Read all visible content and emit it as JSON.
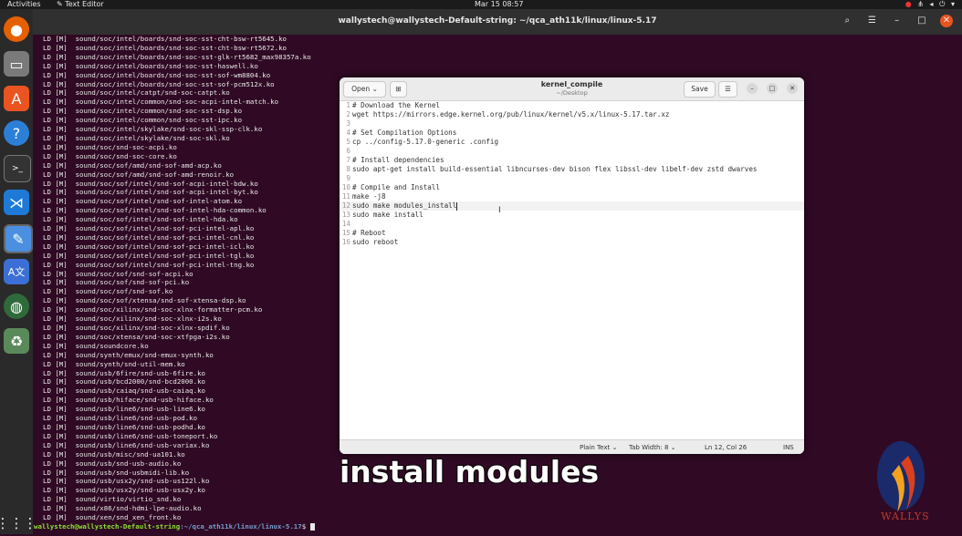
{
  "topbar": {
    "activities": "Activities",
    "app_name": "Text Editor",
    "clock": "Mar 15  08:57"
  },
  "terminal": {
    "title": "wallystech@wallystech-Default-string: ~/qca_ath11k/linux/linux-5.17",
    "lines": [
      "LD [M]  sound/soc/intel/boards/snd-soc-sst-cht-bsw-rt5645.ko",
      "LD [M]  sound/soc/intel/boards/snd-soc-sst-cht-bsw-rt5672.ko",
      "LD [M]  sound/soc/intel/boards/snd-soc-sst-glk-rt5682_max98357a.ko",
      "LD [M]  sound/soc/intel/boards/snd-soc-sst-haswell.ko",
      "LD [M]  sound/soc/intel/boards/snd-soc-sst-sof-wm8804.ko",
      "LD [M]  sound/soc/intel/boards/snd-soc-sst-sof-pcm512x.ko",
      "LD [M]  sound/soc/intel/catpt/snd-soc-catpt.ko",
      "LD [M]  sound/soc/intel/common/snd-soc-acpi-intel-match.ko",
      "LD [M]  sound/soc/intel/common/snd-soc-sst-dsp.ko",
      "LD [M]  sound/soc/intel/common/snd-soc-sst-ipc.ko",
      "LD [M]  sound/soc/intel/skylake/snd-soc-skl-ssp-clk.ko",
      "LD [M]  sound/soc/intel/skylake/snd-soc-skl.ko",
      "LD [M]  sound/soc/snd-soc-acpi.ko",
      "LD [M]  sound/soc/snd-soc-core.ko",
      "LD [M]  sound/soc/sof/amd/snd-sof-amd-acp.ko",
      "LD [M]  sound/soc/sof/amd/snd-sof-amd-renoir.ko",
      "LD [M]  sound/soc/sof/intel/snd-sof-acpi-intel-bdw.ko",
      "LD [M]  sound/soc/sof/intel/snd-sof-acpi-intel-byt.ko",
      "LD [M]  sound/soc/sof/intel/snd-sof-intel-atom.ko",
      "LD [M]  sound/soc/sof/intel/snd-sof-intel-hda-common.ko",
      "LD [M]  sound/soc/sof/intel/snd-sof-intel-hda.ko",
      "LD [M]  sound/soc/sof/intel/snd-sof-pci-intel-apl.ko",
      "LD [M]  sound/soc/sof/intel/snd-sof-pci-intel-cnl.ko",
      "LD [M]  sound/soc/sof/intel/snd-sof-pci-intel-icl.ko",
      "LD [M]  sound/soc/sof/intel/snd-sof-pci-intel-tgl.ko",
      "LD [M]  sound/soc/sof/intel/snd-sof-pci-intel-tng.ko",
      "LD [M]  sound/soc/sof/snd-sof-acpi.ko",
      "LD [M]  sound/soc/sof/snd-sof-pci.ko",
      "LD [M]  sound/soc/sof/snd-sof.ko",
      "LD [M]  sound/soc/sof/xtensa/snd-sof-xtensa-dsp.ko",
      "LD [M]  sound/soc/xilinx/snd-soc-xlnx-formatter-pcm.ko",
      "LD [M]  sound/soc/xilinx/snd-soc-xlnx-i2s.ko",
      "LD [M]  sound/soc/xilinx/snd-soc-xlnx-spdif.ko",
      "LD [M]  sound/soc/xtensa/snd-soc-xtfpga-i2s.ko",
      "LD [M]  sound/soundcore.ko",
      "LD [M]  sound/synth/emux/snd-emux-synth.ko",
      "LD [M]  sound/synth/snd-util-mem.ko",
      "LD [M]  sound/usb/6fire/snd-usb-6fire.ko",
      "LD [M]  sound/usb/bcd2000/snd-bcd2000.ko",
      "LD [M]  sound/usb/caiaq/snd-usb-caiaq.ko",
      "LD [M]  sound/usb/hiface/snd-usb-hiface.ko",
      "LD [M]  sound/usb/line6/snd-usb-line6.ko",
      "LD [M]  sound/usb/line6/snd-usb-pod.ko",
      "LD [M]  sound/usb/line6/snd-usb-podhd.ko",
      "LD [M]  sound/usb/line6/snd-usb-toneport.ko",
      "LD [M]  sound/usb/line6/snd-usb-variax.ko",
      "LD [M]  sound/usb/misc/snd-ua101.ko",
      "LD [M]  sound/usb/snd-usb-audio.ko",
      "LD [M]  sound/usb/snd-usbmidi-lib.ko",
      "LD [M]  sound/usb/usx2y/snd-usb-us122l.ko",
      "LD [M]  sound/usb/usx2y/snd-usb-usx2y.ko",
      "LD [M]  sound/virtio/virtio_snd.ko",
      "LD [M]  sound/x86/snd-hdmi-lpe-audio.ko",
      "LD [M]  sound/xen/snd_xen_front.ko"
    ],
    "prompt_user": "wallystech@wallystech-Default-string",
    "prompt_path": ":~/qca_ath11k/linux/linux-5.17",
    "prompt_symbol": "$ "
  },
  "editor": {
    "open_label": "Open",
    "title": "kernel_compile",
    "subtitle": "~/Desktop",
    "save_label": "Save",
    "lines": [
      "# Download the Kernel",
      "wget https://mirrors.edge.kernel.org/pub/linux/kernel/v5.x/linux-5.17.tar.xz",
      "",
      "# Set Compilation Options",
      "cp ../config-5.17.0-generic .config",
      "",
      "# Install dependencies",
      "sudo apt-get install build-essential libncurses-dev bison flex libssl-dev libelf-dev zstd dwarves",
      "",
      "# Compile and Install",
      "make -j8",
      "sudo make modules_install",
      "sudo make install",
      "",
      "# Reboot",
      "sudo reboot"
    ],
    "status": {
      "language": "Plain Text ⌄",
      "tab_width": "Tab Width: 8 ⌄",
      "position": "Ln 12, Col 26",
      "mode": "INS"
    }
  },
  "caption": "install modules",
  "logo_text": "WALLYS",
  "colors": {
    "terminal_bg": "#300a24",
    "prompt_user": "#8ae234",
    "prompt_path": "#729fcf",
    "dock_bg": "#2a2a2a"
  },
  "icons": [
    "firefox-icon",
    "files-icon",
    "software-icon",
    "help-icon",
    "terminal-icon",
    "vscode-icon",
    "text-editor-icon",
    "translate-icon",
    "browser-icon",
    "trash-icon",
    "apps-grid-icon"
  ]
}
